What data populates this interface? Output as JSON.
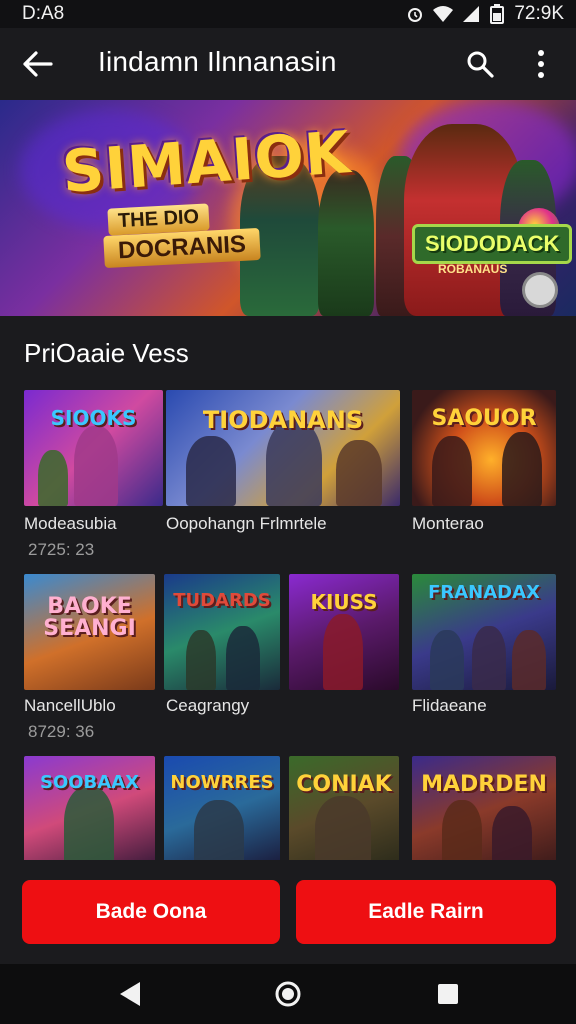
{
  "status_bar": {
    "time": "D:A8",
    "clock_right": "72:9K",
    "icons": [
      "alarm-icon",
      "wifi-icon",
      "signal-icon",
      "battery-icon"
    ]
  },
  "app_bar": {
    "title": "Iindamn Ilnnanasin",
    "icons": [
      "back-arrow-icon",
      "search-icon",
      "more-vert-icon"
    ]
  },
  "banner": {
    "title": "SIMAIOK",
    "subtitle_line1": "THE DIO",
    "subtitle_line2": "DOCRANIS",
    "badge": "SIODODACK",
    "badge_sub": "ROBANAUS"
  },
  "section": {
    "title": "PriOaaie Vess"
  },
  "games": [
    {
      "art_text": "SIOOKS",
      "label": "Modeasubia",
      "sublabel": "2725: 23"
    },
    {
      "art_text": "TIODANANS",
      "label": "Oopohangn Frlmrtele",
      "sublabel": ""
    },
    {
      "art_text": "SAOUOR",
      "label": "Monterao",
      "sublabel": ""
    },
    {
      "art_text": "BAOKE SEANGI",
      "label": "NancellUblo",
      "sublabel": "8729: 36"
    },
    {
      "art_text": "TUDARDS",
      "label": "Ceagrangy",
      "sublabel": ""
    },
    {
      "art_text": "KIUSS",
      "label": "",
      "sublabel": ""
    },
    {
      "art_text": "FRANADAX",
      "label": "Flidaeane",
      "sublabel": ""
    },
    {
      "art_text": "SOOBAAX",
      "label": "",
      "sublabel": ""
    },
    {
      "art_text": "NOWRRES",
      "label": "",
      "sublabel": ""
    },
    {
      "art_text": "CONIAK",
      "label": "",
      "sublabel": ""
    },
    {
      "art_text": "MADRDEN",
      "label": "",
      "sublabel": ""
    }
  ],
  "buttons": {
    "left": "Bade Oona",
    "right": "Eadle Rairn"
  },
  "colors": {
    "background": "#1b1b1e",
    "accent_red": "#ee0f12",
    "text_primary": "#ffffff",
    "text_secondary": "#9c9c9c"
  },
  "nav_bar": {
    "icons": [
      "back-triangle-icon",
      "home-circle-icon",
      "recents-square-icon"
    ]
  }
}
